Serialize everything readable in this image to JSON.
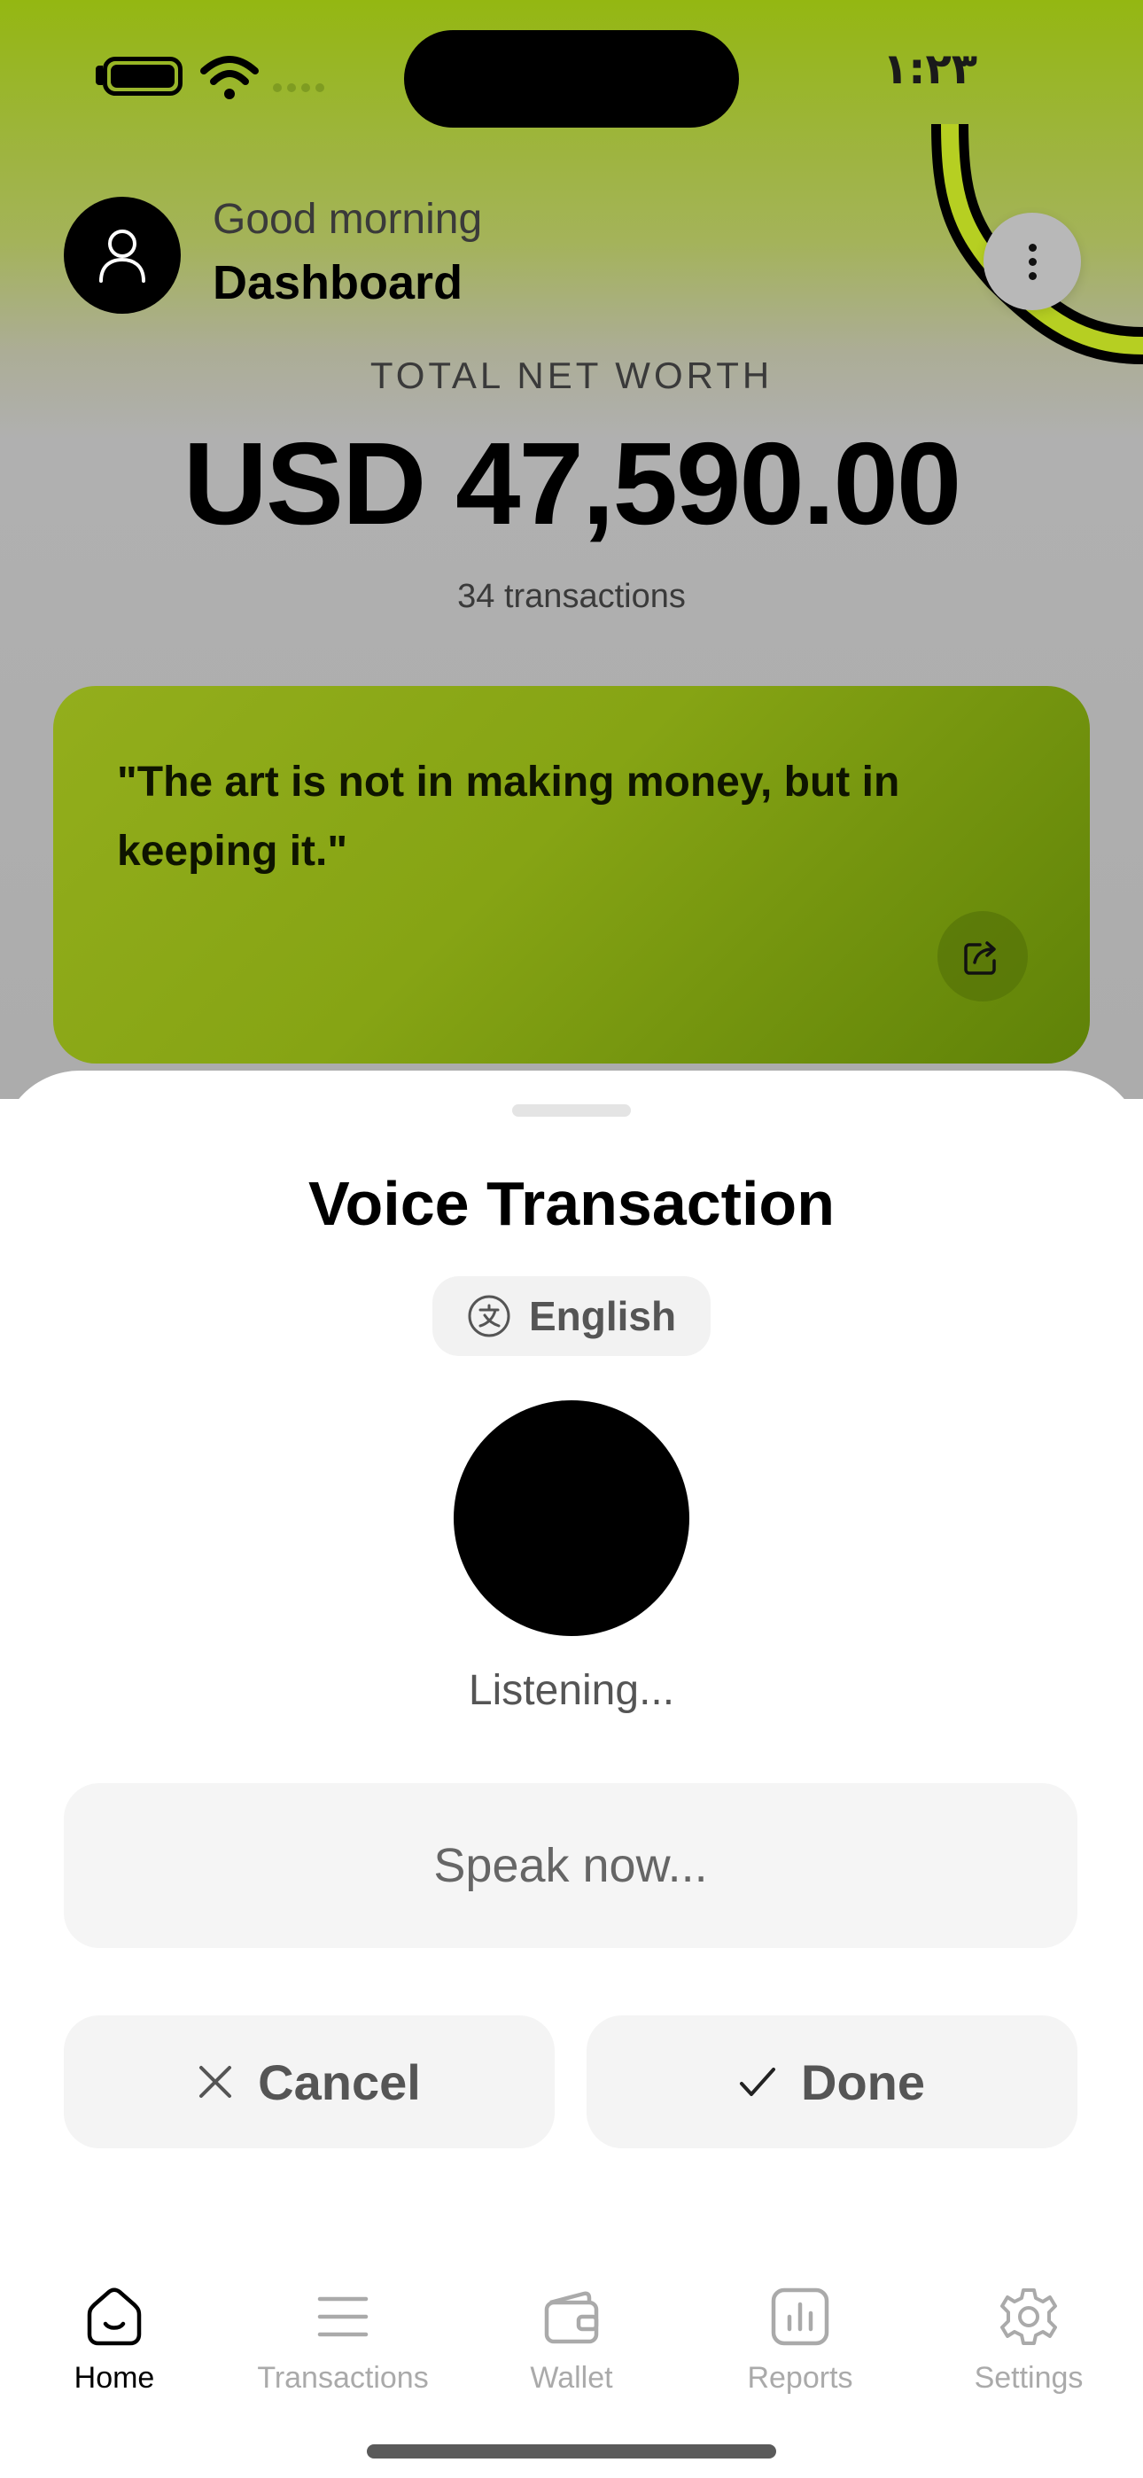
{
  "status_bar": {
    "time": "١:٢٣"
  },
  "header": {
    "greeting": "Good morning",
    "title": "Dashboard"
  },
  "summary": {
    "label": "TOTAL NET WORTH",
    "value": "USD 47,590.00",
    "transactions": "34 transactions"
  },
  "quote": {
    "text": "\"The art is not in making money, but in keeping it.\""
  },
  "voice_sheet": {
    "title": "Voice Transaction",
    "language": "English",
    "status": "Listening...",
    "placeholder": "Speak now...",
    "cancel_label": "Cancel",
    "done_label": "Done"
  },
  "tabs": [
    {
      "label": "Home",
      "icon": "home-icon",
      "active": true
    },
    {
      "label": "Transactions",
      "icon": "list-icon",
      "active": false
    },
    {
      "label": "Wallet",
      "icon": "wallet-icon",
      "active": false
    },
    {
      "label": "Reports",
      "icon": "chart-icon",
      "active": false
    },
    {
      "label": "Settings",
      "icon": "gear-icon",
      "active": false
    }
  ],
  "colors": {
    "accent": "#8fb014",
    "accent_dark": "#5f8208",
    "active_tab": "#000000",
    "inactive_tab": "#aaaaaa"
  }
}
